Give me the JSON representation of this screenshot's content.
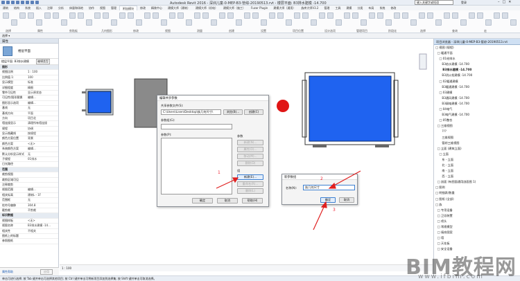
{
  "window": {
    "title": "Autodesk Revit 2016 -   深圳儿童-0-MEP-B3-管综-20190513.rvt - 楼层平面: B3排水建模 -14.700",
    "search_placeholder": "键入关键字或短语",
    "user": "登录"
  },
  "tabs": [
    "建筑",
    "结构",
    "系统",
    "插入",
    "注释",
    "分析",
    "体量和场地",
    "协作",
    "视图",
    "管理",
    "附加模块",
    "修改",
    "精装中心",
    "建模大师（建筑）",
    "建模大师（机电）",
    "建模大师（施工）",
    "Fuzor Plugin",
    "建模大师（通用）",
    "族库大师V3.2",
    "管理",
    "工具",
    "建模",
    "分类",
    "布局",
    "系统",
    "修改"
  ],
  "active_tab_index": 10,
  "ribbon_groups": [
    "选择",
    "属性",
    "剪贴板",
    "几何图形",
    "修改",
    "视图",
    "测量",
    "创建",
    "设置",
    "项目位置",
    "设计选项",
    "管理项目",
    "阶段化",
    "选择",
    "查询",
    "宏"
  ],
  "options_bar": {
    "label": "选择 ▾",
    "sublabel": "修改"
  },
  "properties": {
    "title": "属性",
    "type_name": "楼层平面",
    "selector": "楼层平面: B3排水建模",
    "edit_type": "编辑类型",
    "rows": [
      {
        "k": "视图比例",
        "v": "1 : 100"
      },
      {
        "k": "比例值 1:",
        "v": "100"
      },
      {
        "k": "显示模型",
        "v": "标准"
      },
      {
        "k": "详细程度",
        "v": "精细"
      },
      {
        "k": "零件可见性",
        "v": "显示原状态"
      },
      {
        "k": "可见性/图形替换",
        "v": "编辑..."
      },
      {
        "k": "图形显示选项",
        "v": "编辑..."
      },
      {
        "k": "基线",
        "v": "无"
      },
      {
        "k": "基线方向",
        "v": "平面"
      },
      {
        "k": "方向",
        "v": "项目北"
      },
      {
        "k": "墙连接显示",
        "v": "清理所有墙连接"
      },
      {
        "k": "规程",
        "v": "协调"
      },
      {
        "k": "显示隐藏线",
        "v": "按规程"
      },
      {
        "k": "颜色方案位置",
        "v": "背景"
      },
      {
        "k": "颜色方案",
        "v": "<无>"
      },
      {
        "k": "系统颜色方案",
        "v": "编辑..."
      },
      {
        "k": "默认分析显示样式",
        "v": "无"
      },
      {
        "k": "子规程",
        "v": "01排水"
      },
      {
        "k": "日光路径",
        "v": ""
      }
    ],
    "sections": [
      "范围",
      "标识数据",
      "阶段化"
    ],
    "range_rows": [
      {
        "k": "裁剪视图",
        "v": ""
      },
      {
        "k": "裁剪区域可见",
        "v": ""
      },
      {
        "k": "注释裁剪",
        "v": ""
      },
      {
        "k": "视图范围",
        "v": "编辑..."
      },
      {
        "k": "相关标高",
        "v": "建筑L - 1F"
      },
      {
        "k": "范围框",
        "v": "无"
      },
      {
        "k": "柱符号偏移",
        "v": "304.8"
      },
      {
        "k": "截剪裁",
        "v": "不剪裁"
      }
    ],
    "id_rows": [
      {
        "k": "视图样板",
        "v": "<无>"
      },
      {
        "k": "视图名称",
        "v": "B3排水建模 -14..."
      },
      {
        "k": "相关性",
        "v": "不相关"
      },
      {
        "k": "图纸上的标题",
        "v": ""
      },
      {
        "k": "参照图纸",
        "v": ""
      }
    ],
    "help_link": "属性帮助",
    "apply": "应用"
  },
  "view_control": {
    "scale": "1 : 100"
  },
  "status": {
    "text": "单击可进行选择; 按 Tab 键并单击可选择其他项目; 按 Ctrl 键并单击可将新项目添加到选择集; 按 Shift 键并单击可取消选择。"
  },
  "browser": {
    "title": "项目浏览器 - 深圳儿童-0-MEP-B3-管综-20190513.rvt",
    "items": [
      "□ 视图 (规程)",
      "  □ 暖通平面",
      "    □ 01给排水",
      "       B3给水建模 -14.700",
      "       B3排水建模 -14.700",
      "       B3消火栓建模 -14.700",
      "    □ 02暖通建模",
      "       B3暖通建模 -14.700",
      "    □ 03建模",
      "       B3通风建模 -14.700",
      "       B3弱电建模 -14.700",
      "    □ 04电气",
      "       B3电气建模 -14.700",
      "    □ 05整合",
      "  □ 三维视图",
      "       ???",
      "       三维视图",
      "       管综三维视图",
      "  □ 立面 (建筑立面)",
      "    □ 立面",
      "       东 - 立面",
      "       北 - 立面",
      "       南 - 立面",
      "       西 - 立面",
      "  □ 剖面 (有图面通用剖面图 1)",
      "□ 图例",
      "□ 明细表/数量",
      "□ 图纸 (全部)",
      "□ 族",
      "  □ 专用设备",
      "  □ 卫浴装置",
      "  □ 喷头",
      "  □ 常规模型",
      "  □ 填充图案",
      "  □ 墙",
      "  □ 天花板",
      "  □ 安全设备"
    ]
  },
  "dialog_params": {
    "title": "编辑共享参数",
    "file_label": "共享参数文件(S):",
    "file_path": "C:\\Users\\Lisen\\Desktop\\族几何尺寸\\",
    "browse": "浏览(B)...",
    "create": "创建(C)",
    "group_label": "参数组(G):",
    "params_label": "参数(P):",
    "params_side_label": "参数",
    "btn_new_param": "新建(N)...",
    "btn_props": "属性(O)...",
    "btn_move": "移动(M)...",
    "btn_delete": "删除(D)",
    "group_side_label": "组",
    "btn_new_group": "新建(E)...",
    "btn_rename": "重命名(R)...",
    "btn_delete_group": "删除(L)",
    "ok": "确定",
    "cancel": "取消",
    "help": "帮助(H)"
  },
  "dialog_new_group": {
    "title": "新参数组",
    "name_label": "名称(N):",
    "name_value": "族几何尺寸",
    "ok": "确定",
    "cancel": "取消"
  },
  "annotations": [
    "1",
    "2",
    "3"
  ],
  "watermark": {
    "brand": "BIM教程网",
    "url": "www.ifbim.com"
  },
  "colors": {
    "equipment_blue": "#1f63f0",
    "red_marker": "#e01515",
    "annotation_red": "#e02020"
  }
}
